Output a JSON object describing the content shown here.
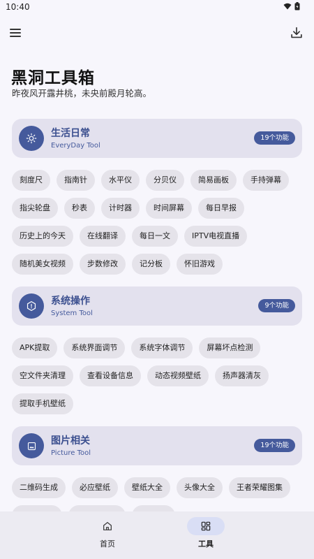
{
  "status": {
    "time": "10:40"
  },
  "header": {
    "title": "黑洞工具箱",
    "subtitle": "昨夜风开露井桃，未央前殿月轮高。"
  },
  "sections": [
    {
      "title": "生活日常",
      "subtitle": "EveryDay Tool",
      "badge": "19个功能",
      "icon": "sun-icon",
      "rows": [
        [
          "刻度尺",
          "指南针",
          "水平仪",
          "分贝仪",
          "简易画板",
          "手持弹幕"
        ],
        [
          "指尖轮盘",
          "秒表",
          "计时器",
          "时间屏幕",
          "每日早报"
        ],
        [
          "历史上的今天",
          "在线翻译",
          "每日一文",
          "IPTV电视直播"
        ],
        [
          "随机美女视频",
          "步数修改",
          "记分板",
          "怀旧游戏"
        ]
      ]
    },
    {
      "title": "系统操作",
      "subtitle": "System Tool",
      "badge": "9个功能",
      "icon": "settings-icon",
      "rows": [
        [
          "APK提取",
          "系统界面调节",
          "系统字体调节",
          "屏幕坏点检测"
        ],
        [
          "空文件夹清理",
          "查看设备信息",
          "动态视频壁纸",
          "扬声器清灰"
        ],
        [
          "提取手机壁纸"
        ]
      ]
    },
    {
      "title": "图片相关",
      "subtitle": "Picture Tool",
      "badge": "19个功能",
      "icon": "image-icon",
      "rows": [
        [
          "二维码生成",
          "必应壁纸",
          "壁纸大全",
          "头像大全",
          "王者荣耀图集"
        ]
      ]
    }
  ],
  "nav": {
    "items": [
      {
        "label": "首页",
        "icon": "home-icon"
      },
      {
        "label": "工具",
        "icon": "grid-icon"
      }
    ]
  },
  "colors": {
    "accent": "#455a9c",
    "card": "#e3e1ee",
    "chip": "#e5e3ea",
    "background": "#f7f6fc"
  }
}
